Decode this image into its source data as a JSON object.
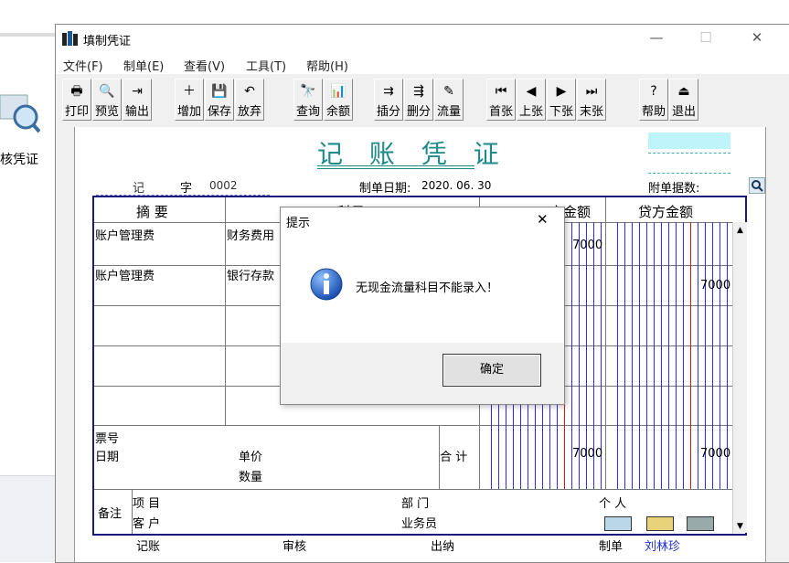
{
  "desktop": {
    "side_label": "核凭证"
  },
  "window": {
    "title": "填制凭证",
    "controls": {
      "minimize": "—",
      "maximize": "☐",
      "close": "✕"
    }
  },
  "menu": [
    "文件(F)",
    "制单(E)",
    "查看(V)",
    "工具(T)",
    "帮助(H)"
  ],
  "toolbar": [
    {
      "label": "打印",
      "icon": "printer-icon",
      "glyph": "🖶"
    },
    {
      "label": "预览",
      "icon": "preview-icon",
      "glyph": "🔍"
    },
    {
      "label": "输出",
      "icon": "export-icon",
      "glyph": "⇥"
    },
    {
      "label": "增加",
      "icon": "add-icon",
      "glyph": "＋"
    },
    {
      "label": "保存",
      "icon": "save-icon",
      "glyph": "💾"
    },
    {
      "label": "放弃",
      "icon": "undo-icon",
      "glyph": "↶"
    },
    {
      "label": "查询",
      "icon": "binoculars-icon",
      "glyph": "🔭"
    },
    {
      "label": "余额",
      "icon": "chart-icon",
      "glyph": "📊"
    },
    {
      "label": "插分",
      "icon": "insert-row-icon",
      "glyph": "⇉"
    },
    {
      "label": "删分",
      "icon": "delete-row-icon",
      "glyph": "⇶"
    },
    {
      "label": "流量",
      "icon": "cashflow-icon",
      "glyph": "✎"
    },
    {
      "label": "首张",
      "icon": "first-icon",
      "glyph": "⏮"
    },
    {
      "label": "上张",
      "icon": "prev-icon",
      "glyph": "◀"
    },
    {
      "label": "下张",
      "icon": "next-icon",
      "glyph": "▶"
    },
    {
      "label": "末张",
      "icon": "last-icon",
      "glyph": "⏭"
    },
    {
      "label": "帮助",
      "icon": "help-icon",
      "glyph": "?"
    },
    {
      "label": "退出",
      "icon": "exit-icon",
      "glyph": "⏏"
    }
  ],
  "voucher": {
    "title": "记 账 凭 证",
    "type_label": "记",
    "zi_label": "字",
    "number": "0002",
    "date_label": "制单日期:",
    "date": "2020. 06. 30",
    "attach_label": "附单据数:",
    "col_summary": "摘  要",
    "col_credit": "贷方金额",
    "col_debit_partial": "方金额",
    "col_subject_partial": "科目",
    "rows": [
      {
        "summary": "账户管理费",
        "subject": "财务费用",
        "debit": "7000",
        "credit": ""
      },
      {
        "summary": "账户管理费",
        "subject": "银行存款",
        "debit": "",
        "credit": "7000"
      }
    ],
    "ticket_label": "票号",
    "date_row_label": "日期",
    "price_label": "单价",
    "qty_label": "数量",
    "total_label": "合 计",
    "total_debit": "7000",
    "total_credit": "7000",
    "remark_label": "备注",
    "project_label": "项  目",
    "customer_label": "客  户",
    "dept_label": "部  门",
    "person_label": "个  人",
    "salesman_label": "业务员",
    "footer": {
      "bookkeep": "记账",
      "audit": "审核",
      "cashier": "出纳",
      "maker": "制单",
      "maker_name": "刘林珍"
    }
  },
  "dialog": {
    "title": "提示",
    "message": "无现金流量科目不能录入！",
    "ok": "确定",
    "close": "✕"
  },
  "colors": {
    "accent_title": "#1e8a8a",
    "grid_blue": "#2b2bff",
    "grid_red": "#e01010",
    "maker_name": "#1f2fd0"
  }
}
